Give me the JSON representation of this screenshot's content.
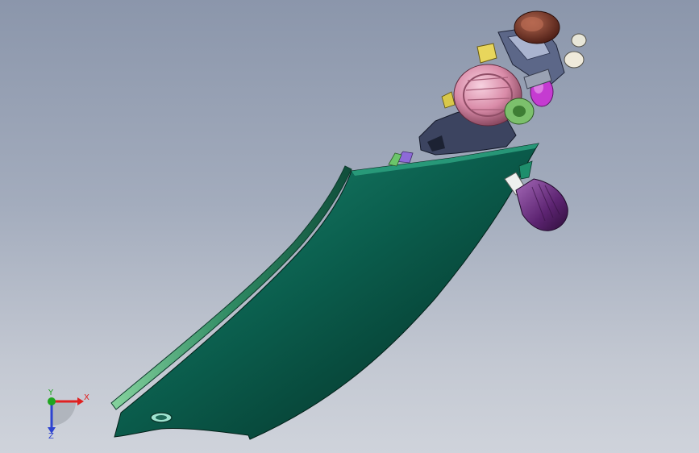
{
  "viewport": {
    "background_top": "#8b96ab",
    "background_bottom": "#cfd3db"
  },
  "model": {
    "panel_color": "#0f6a58",
    "rail_color": "#3f9b74",
    "motor_housing_color": "#e3a7bd",
    "bracket_color": "#4b5470",
    "knob_color": "#6b2f7e",
    "gear_color": "#78bd6a",
    "cap_color": "#7a4236"
  },
  "triad": {
    "x_label": "X",
    "y_label": "Y",
    "z_label": "Z",
    "x_color": "#e02020",
    "y_color": "#1fa51f",
    "z_color": "#2d43d0"
  }
}
